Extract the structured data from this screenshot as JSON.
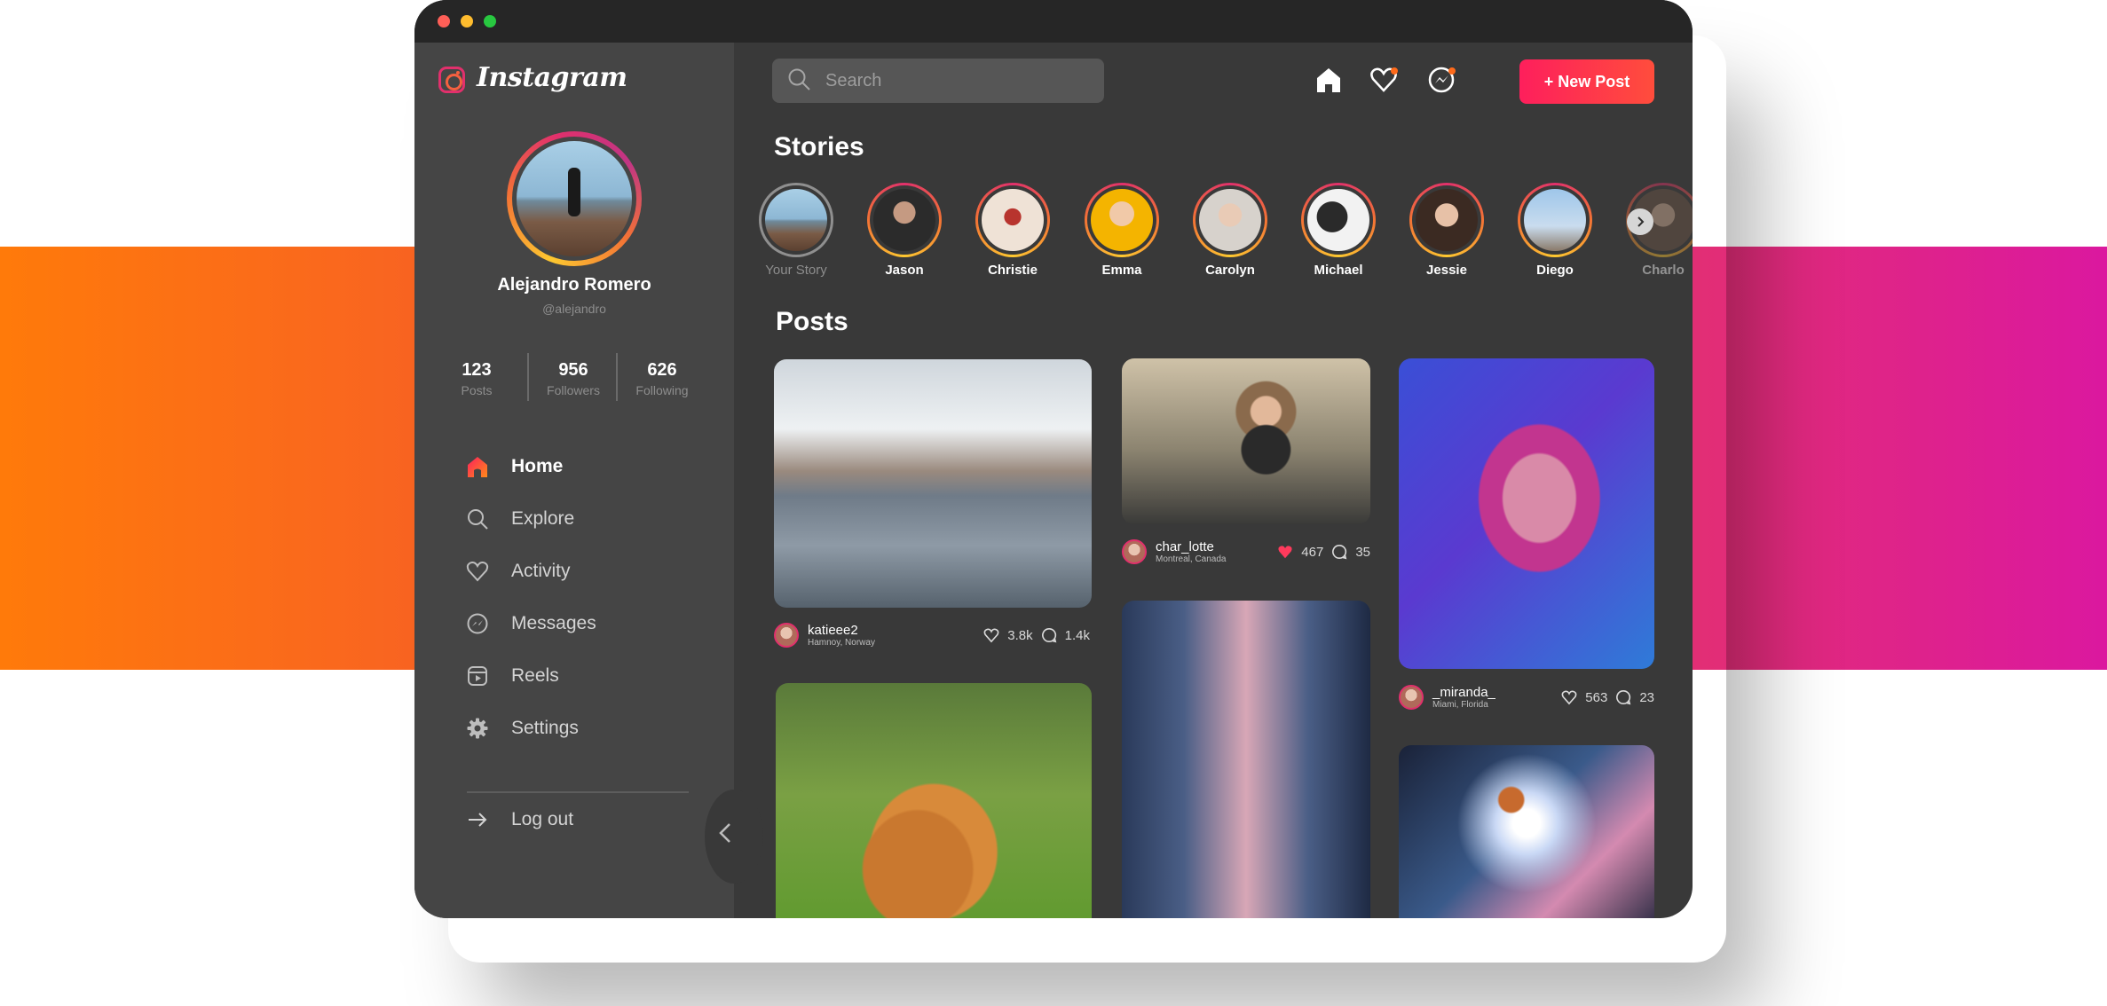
{
  "app": {
    "logo_text": "Instagram"
  },
  "profile": {
    "name": "Alejandro Romero",
    "handle": "@alejandro",
    "stats": [
      {
        "value": "123",
        "label": "Posts"
      },
      {
        "value": "956",
        "label": "Followers"
      },
      {
        "value": "626",
        "label": "Following"
      }
    ]
  },
  "nav": {
    "items": [
      {
        "label": "Home",
        "icon": "home-icon",
        "active": true
      },
      {
        "label": "Explore",
        "icon": "search-icon"
      },
      {
        "label": "Activity",
        "icon": "heart-icon"
      },
      {
        "label": "Messages",
        "icon": "messenger-icon"
      },
      {
        "label": "Reels",
        "icon": "reels-icon"
      },
      {
        "label": "Settings",
        "icon": "gear-icon"
      }
    ],
    "logout_label": "Log out"
  },
  "header": {
    "search_placeholder": "Search",
    "new_post_label": "+ New Post"
  },
  "stories": {
    "title": "Stories",
    "items": [
      {
        "name": "Your Story",
        "seen": true
      },
      {
        "name": "Jason"
      },
      {
        "name": "Christie"
      },
      {
        "name": "Emma"
      },
      {
        "name": "Carolyn"
      },
      {
        "name": "Michael"
      },
      {
        "name": "Jessie"
      },
      {
        "name": "Diego"
      },
      {
        "name": "Charlo"
      }
    ]
  },
  "posts": {
    "title": "Posts",
    "items": [
      {
        "username": "katieee2",
        "location": "Hamnoy, Norway",
        "likes": "3.8k",
        "comments": "1.4k",
        "liked": false
      },
      {
        "username": "char_lotte",
        "location": "Montreal, Canada",
        "likes": "467",
        "comments": "35",
        "liked": true
      },
      {
        "username": "_miranda_",
        "location": "Miami, Florida",
        "likes": "563",
        "comments": "23",
        "liked": false
      }
    ]
  },
  "colors": {
    "accent": "#fe1f5c",
    "accent_orange": "#ff6a1a",
    "sidebar": "#454545",
    "main": "#393939",
    "titlebar": "#262626"
  }
}
